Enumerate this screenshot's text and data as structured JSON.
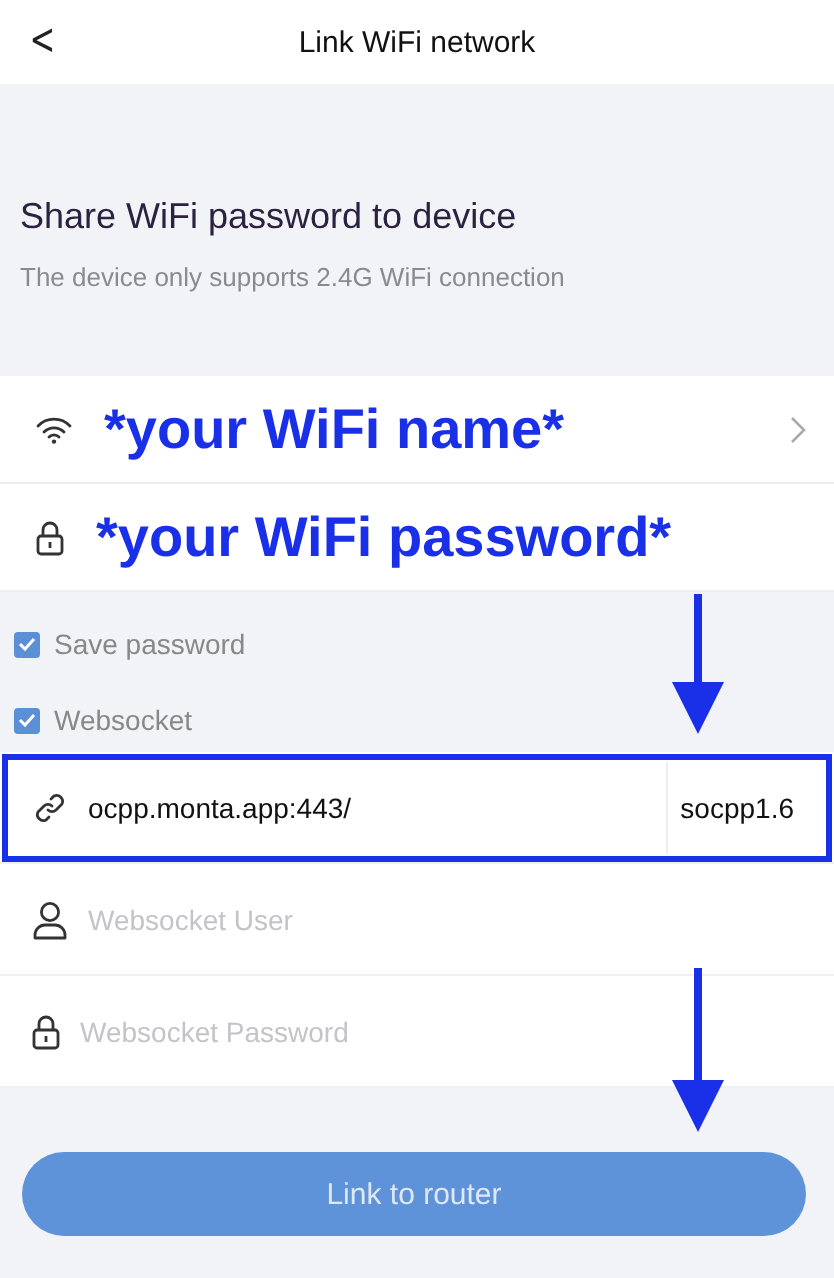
{
  "header": {
    "title": "Link WiFi network",
    "back": "<"
  },
  "intro": {
    "title": "Share WiFi password to device",
    "subtitle": "The device only supports 2.4G WiFi connection"
  },
  "wifi_fields": [
    {
      "kind": "network",
      "value": "*your WiFi name*",
      "chevron": true
    },
    {
      "kind": "password",
      "value": "*your WiFi password*",
      "chevron": false
    }
  ],
  "options": [
    {
      "label": "Save password",
      "checked": true
    },
    {
      "label": "Websocket",
      "checked": true
    }
  ],
  "websocket_fields": [
    {
      "kind": "url",
      "value": "ocpp.monta.app:443/",
      "suffix": "socpp1.6",
      "highlighted": true
    },
    {
      "kind": "user",
      "placeholder": "Websocket User",
      "highlighted": false
    },
    {
      "kind": "password",
      "placeholder": "Websocket Password",
      "highlighted": false
    }
  ],
  "button": {
    "label": "Link to router",
    "disabled": true
  }
}
